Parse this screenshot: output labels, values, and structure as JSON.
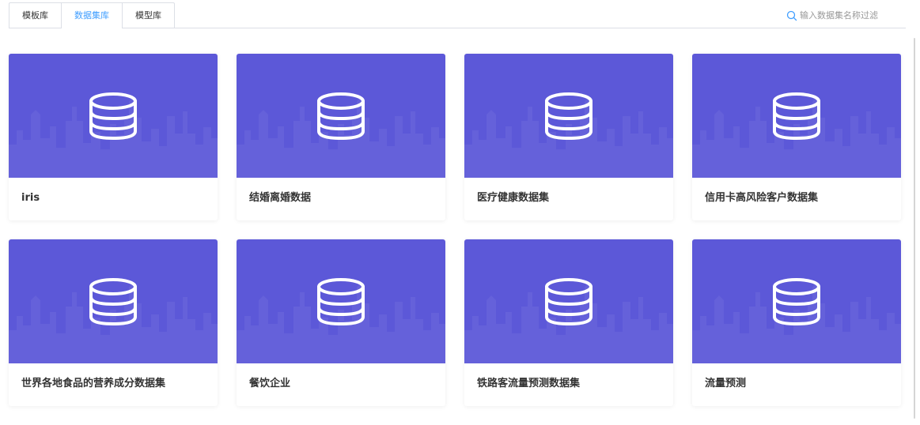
{
  "tabs": [
    {
      "label": "模板库",
      "active": false
    },
    {
      "label": "数据集库",
      "active": true
    },
    {
      "label": "模型库",
      "active": false
    }
  ],
  "search": {
    "placeholder": "输入数据集名称过滤",
    "value": "",
    "icon": "search-icon"
  },
  "colors": {
    "accent": "#409eff",
    "card_banner": "#5c58d8"
  },
  "datasets": [
    {
      "title": "iris",
      "icon": "database-icon"
    },
    {
      "title": "结婚离婚数据",
      "icon": "database-icon"
    },
    {
      "title": "医疗健康数据集",
      "icon": "database-icon"
    },
    {
      "title": "信用卡高风险客户数据集",
      "icon": "database-icon"
    },
    {
      "title": "世界各地食品的营养成分数据集",
      "icon": "database-icon"
    },
    {
      "title": "餐饮企业",
      "icon": "database-icon"
    },
    {
      "title": "铁路客流量预测数据集",
      "icon": "database-icon"
    },
    {
      "title": "流量预测",
      "icon": "database-icon"
    }
  ]
}
